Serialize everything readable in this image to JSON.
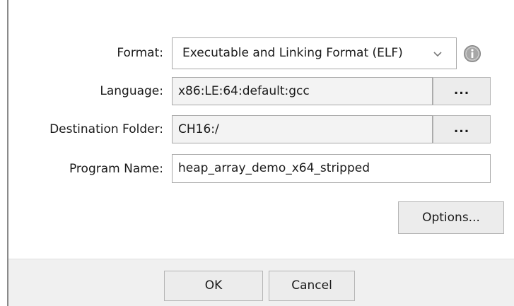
{
  "form": {
    "format_label": "Format:",
    "format_value": "Executable and Linking Format (ELF)",
    "language_label": "Language:",
    "language_value": "x86:LE:64:default:gcc",
    "destination_label": "Destination Folder:",
    "destination_value": "CH16:/",
    "program_name_label": "Program Name:",
    "program_name_value": "heap_array_demo_x64_stripped",
    "browse_label": "...",
    "options_label": "Options..."
  },
  "footer": {
    "ok_label": "OK",
    "cancel_label": "Cancel"
  },
  "icons": {
    "format_dropdown": "chevron-down-icon",
    "format_info": "info-icon"
  }
}
